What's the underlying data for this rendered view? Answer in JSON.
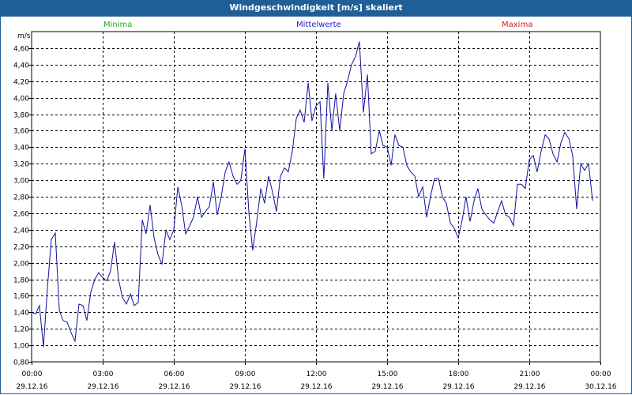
{
  "window": {
    "title": "Windgeschwindigkeit [m/s] skaliert"
  },
  "legend": [
    {
      "label": "Minima",
      "color": "#22aa22"
    },
    {
      "label": "Mittelwerte",
      "color": "#2020cc"
    },
    {
      "label": "Maxima",
      "color": "#cc2222"
    }
  ],
  "colors": {
    "titlebar": "#1f5e96",
    "line": "#1010a0",
    "grid": "#000000"
  },
  "chart_data": {
    "type": "line",
    "ylabel": "m/s",
    "ylim": [
      0.8,
      4.8
    ],
    "y_ticks": [
      "0,80",
      "1,00",
      "1,20",
      "1,40",
      "1,60",
      "1,80",
      "2,00",
      "2,20",
      "2,40",
      "2,60",
      "2,80",
      "3,00",
      "3,20",
      "3,40",
      "3,60",
      "3,80",
      "4,00",
      "4,20",
      "4,40",
      "4,60"
    ],
    "x_ticks": [
      {
        "time": "00:00",
        "date": "29.12.16"
      },
      {
        "time": "03:00",
        "date": "29.12.16"
      },
      {
        "time": "06:00",
        "date": "29.12.16"
      },
      {
        "time": "09:00",
        "date": "29.12.16"
      },
      {
        "time": "12:00",
        "date": "29.12.16"
      },
      {
        "time": "15:00",
        "date": "29.12.16"
      },
      {
        "time": "18:00",
        "date": "29.12.16"
      },
      {
        "time": "21:00",
        "date": "29.12.16"
      },
      {
        "time": "00:00",
        "date": "30.12.16"
      }
    ],
    "xlim_hours": [
      0,
      24
    ],
    "grid": true,
    "series": [
      {
        "name": "Mittelwerte",
        "x_hours": [
          0.0,
          0.17,
          0.33,
          0.5,
          0.67,
          0.83,
          1.0,
          1.17,
          1.33,
          1.5,
          1.67,
          1.83,
          2.0,
          2.17,
          2.33,
          2.5,
          2.67,
          2.83,
          3.0,
          3.17,
          3.33,
          3.5,
          3.67,
          3.83,
          4.0,
          4.17,
          4.33,
          4.5,
          4.67,
          4.83,
          5.0,
          5.17,
          5.33,
          5.5,
          5.67,
          5.83,
          6.0,
          6.17,
          6.33,
          6.5,
          6.67,
          6.83,
          7.0,
          7.17,
          7.33,
          7.5,
          7.67,
          7.83,
          8.0,
          8.17,
          8.33,
          8.5,
          8.67,
          8.83,
          9.0,
          9.17,
          9.33,
          9.5,
          9.67,
          9.83,
          10.0,
          10.17,
          10.33,
          10.5,
          10.67,
          10.83,
          11.0,
          11.17,
          11.33,
          11.5,
          11.67,
          11.83,
          12.0,
          12.17,
          12.33,
          12.5,
          12.67,
          12.83,
          13.0,
          13.17,
          13.33,
          13.5,
          13.67,
          13.83,
          14.0,
          14.17,
          14.33,
          14.5,
          14.67,
          14.83,
          15.0,
          15.17,
          15.33,
          15.5,
          15.67,
          15.83,
          16.0,
          16.17,
          16.33,
          16.5,
          16.67,
          16.83,
          17.0,
          17.17,
          17.33,
          17.5,
          17.67,
          17.83,
          18.0,
          18.17,
          18.33,
          18.5,
          18.67,
          18.83,
          19.0,
          19.17,
          19.33,
          19.5,
          19.67,
          19.83,
          20.0,
          20.17,
          20.33,
          20.5,
          20.67,
          20.83,
          21.0,
          21.17,
          21.33,
          21.5,
          21.67,
          21.83,
          22.0,
          22.17,
          22.33,
          22.5,
          22.67,
          22.83,
          23.0,
          23.17,
          23.33,
          23.5,
          23.67,
          23.83,
          24.0
        ],
        "y": [
          1.4,
          1.38,
          1.48,
          0.98,
          1.7,
          2.28,
          2.36,
          1.42,
          1.3,
          1.28,
          1.15,
          1.05,
          1.5,
          1.48,
          1.3,
          1.65,
          1.8,
          1.88,
          1.82,
          1.78,
          1.9,
          2.25,
          1.8,
          1.58,
          1.5,
          1.62,
          1.48,
          1.52,
          2.52,
          2.35,
          2.7,
          2.3,
          2.1,
          1.98,
          2.4,
          2.28,
          2.4,
          2.92,
          2.7,
          2.35,
          2.45,
          2.55,
          2.8,
          2.55,
          2.62,
          2.68,
          2.98,
          2.58,
          2.8,
          3.1,
          3.22,
          3.05,
          2.95,
          3.0,
          3.38,
          2.6,
          2.15,
          2.5,
          2.9,
          2.72,
          3.05,
          2.85,
          2.62,
          3.05,
          3.15,
          3.1,
          3.35,
          3.75,
          3.85,
          3.7,
          4.18,
          3.72,
          3.9,
          3.95,
          3.02,
          4.18,
          3.6,
          4.05,
          3.6,
          4.05,
          4.2,
          4.4,
          4.5,
          4.68,
          3.82,
          4.28,
          3.32,
          3.35,
          3.6,
          3.42,
          3.4,
          3.18,
          3.55,
          3.42,
          3.4,
          3.18,
          3.1,
          3.05,
          2.8,
          2.92,
          2.55,
          2.8,
          3.02,
          3.02,
          2.8,
          2.72,
          2.48,
          2.42,
          2.3,
          2.52,
          2.8,
          2.5,
          2.75,
          2.9,
          2.65,
          2.58,
          2.52,
          2.48,
          2.62,
          2.75,
          2.58,
          2.55,
          2.45,
          2.95,
          2.95,
          2.9,
          3.25,
          3.3,
          3.1,
          3.35,
          3.55,
          3.5,
          3.32,
          3.22,
          3.45,
          3.58,
          3.5,
          3.3,
          2.65,
          3.2,
          3.12,
          3.2,
          2.75
        ]
      }
    ]
  }
}
